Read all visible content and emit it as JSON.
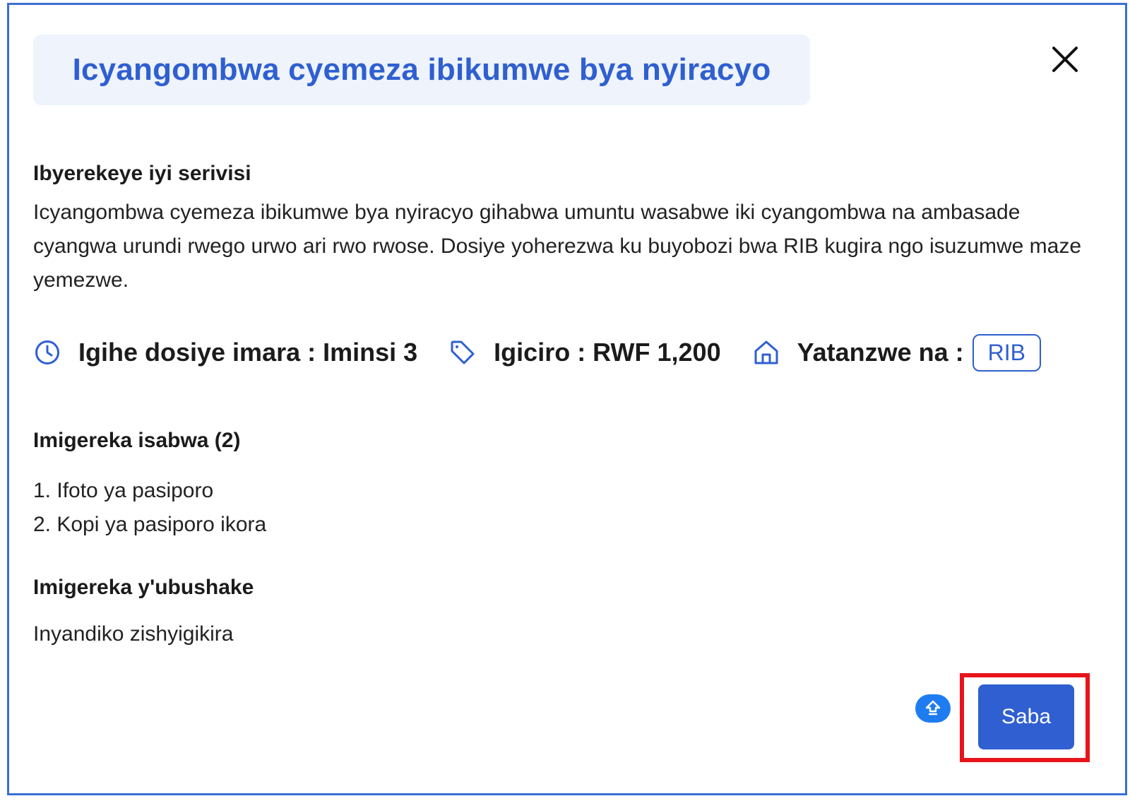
{
  "modal": {
    "title": "Icyangombwa cyemeza ibikumwe bya nyiracyo",
    "close_icon": "close-icon"
  },
  "about": {
    "heading": "Ibyerekeye iyi serivisi",
    "description": "Icyangombwa cyemeza ibikumwe bya nyiracyo gihabwa umuntu wasabwe iki cyangombwa na ambasade cyangwa urundi rwego urwo ari rwo rwose. Dosiye yoherezwa ku buyobozi bwa RIB kugira ngo isuzumwe maze yemezwe."
  },
  "info": {
    "processing_time": "Igihe dosiye imara : Iminsi 3",
    "price": "Igiciro : RWF 1,200",
    "provider_label": "Yatanzwe na :",
    "provider_badge": "RIB",
    "icons": [
      "clock-icon",
      "tag-icon",
      "home-icon"
    ]
  },
  "required_documents": {
    "heading": "Imigereka isabwa (2)",
    "items": [
      "1. Ifoto ya pasiporo",
      "2. Kopi ya pasiporo ikora"
    ]
  },
  "optional_documents": {
    "heading": "Imigereka y'ubushake",
    "text": "Inyandiko zishyigikira"
  },
  "actions": {
    "apply_label": "Saba",
    "upload_icon": "upload-icon"
  },
  "colors": {
    "accent": "#2f5fd0",
    "highlight": "#e8141c",
    "title_bg": "#eef3fc",
    "fab": "#1f7cf0"
  }
}
